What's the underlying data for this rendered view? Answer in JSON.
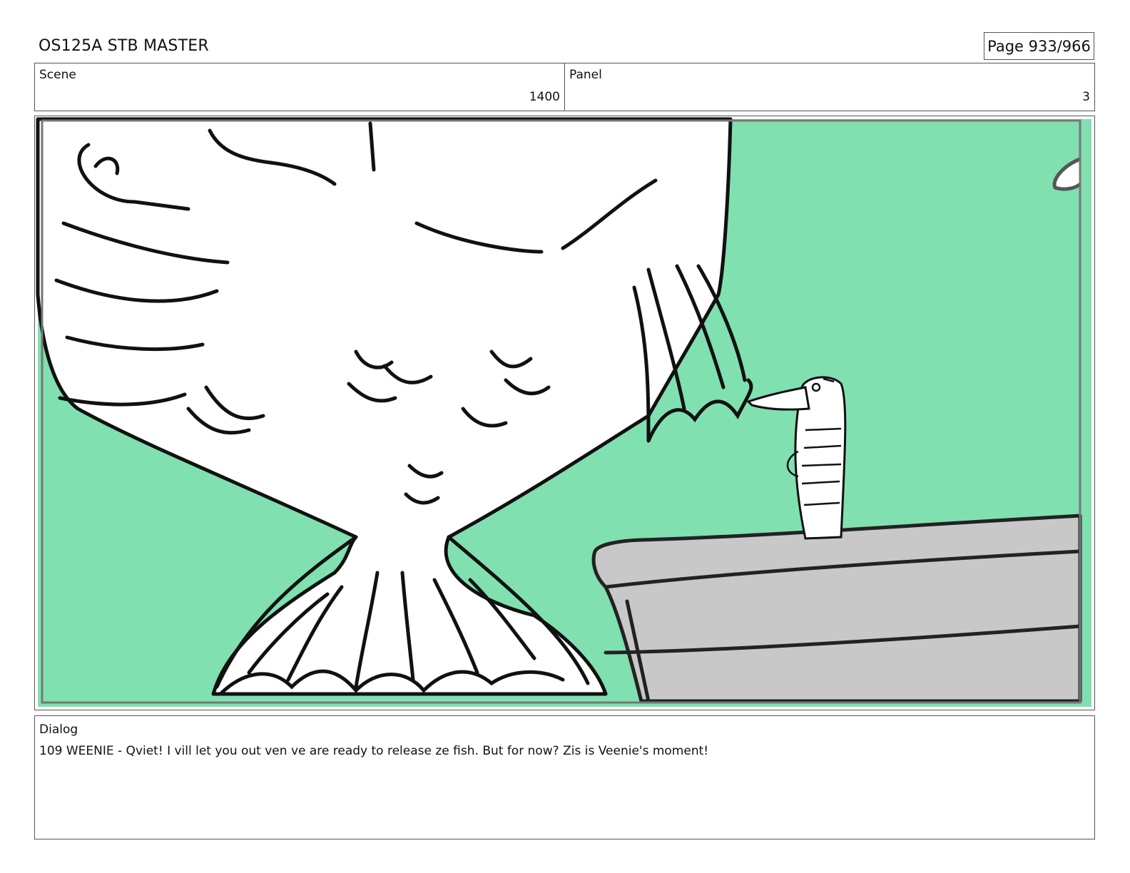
{
  "header": {
    "title": "OS125A STB MASTER",
    "page": "Page 933/966"
  },
  "info": {
    "scene_label": "Scene",
    "scene_value": "1400",
    "panel_label": "Panel",
    "panel_value": "3"
  },
  "artwork": {
    "background_color": "#80e0b0",
    "fish_color": "#ffffff",
    "ledge_color": "#c8c8c8",
    "line_color": "#111111"
  },
  "dialog": {
    "label": "Dialog",
    "text": "109 WEENIE - Qviet! I vill let you out ven ve are ready to release ze fish. But for now? Zis is Veenie's moment!"
  }
}
